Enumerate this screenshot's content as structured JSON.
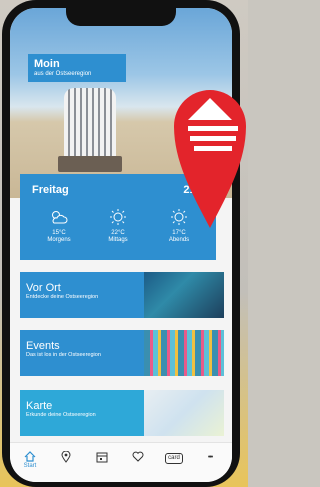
{
  "hero": {
    "greeting_title": "Moin",
    "greeting_subtitle": "aus der Ostseeregion"
  },
  "weather": {
    "day": "Freitag",
    "current_temp": "21°C",
    "slots": [
      {
        "temp": "15°C",
        "label": "Morgens",
        "icon": "partly-cloudy-icon"
      },
      {
        "temp": "22°C",
        "label": "Mittags",
        "icon": "sun-icon"
      },
      {
        "temp": "17°C",
        "label": "Abends",
        "icon": "sun-icon"
      }
    ]
  },
  "tiles": [
    {
      "title": "Vor Ort",
      "subtitle": "Entdecke deine Ostseeregion"
    },
    {
      "title": "Events",
      "subtitle": "Das ist los in der Ostseeregion"
    },
    {
      "title": "Karte",
      "subtitle": "Erkunde deine Ostseeregion"
    }
  ],
  "nav": {
    "items": [
      {
        "icon": "home-icon",
        "label": "Start",
        "active": true
      },
      {
        "icon": "location-pin-icon",
        "label": ""
      },
      {
        "icon": "calendar-icon",
        "label": ""
      },
      {
        "icon": "heart-icon",
        "label": ""
      },
      {
        "icon": "card-icon",
        "label": "card"
      },
      {
        "icon": "more-icon",
        "label": "•••"
      }
    ]
  },
  "colors": {
    "primary": "#2e8fd0",
    "map_tile": "#2ea8d8",
    "pin": "#e3242b"
  }
}
